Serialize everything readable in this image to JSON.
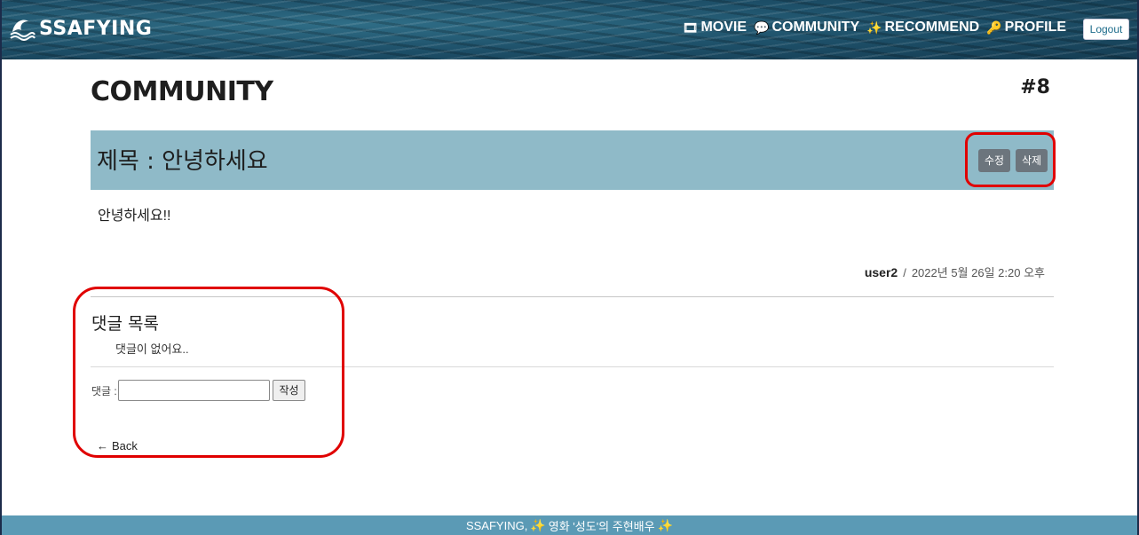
{
  "navbar": {
    "brand": "SSAFYING",
    "brand_icon": "wave-icon",
    "links": [
      {
        "label": "MOVIE",
        "icon": "film-icon",
        "glyph": "🎞"
      },
      {
        "label": "COMMUNITY",
        "icon": "chat-icon",
        "glyph": "💬"
      },
      {
        "label": "RECOMMEND",
        "icon": "sparkle-icon",
        "glyph": "✨"
      },
      {
        "label": "PROFILE",
        "icon": "key-icon",
        "glyph": "🔑"
      }
    ],
    "logout_label": "Logout"
  },
  "page": {
    "title": "COMMUNITY",
    "post_number": "#8"
  },
  "post": {
    "title": "제목 : 안녕하세요",
    "edit_label": "수정",
    "delete_label": "삭제",
    "content": "안녕하세요!!",
    "author": "user2",
    "separator": "/",
    "date": "2022년 5월 26일 2:20 오후"
  },
  "comments": {
    "heading": "댓글 목록",
    "empty_message": "댓글이 없어요..",
    "input_label": "댓글 :",
    "input_value": "",
    "submit_label": "작성"
  },
  "back": {
    "arrow": "←",
    "label": "Back"
  },
  "footer": {
    "text_before": "SSAFYING,",
    "text_middle": "영화 '성도'의 주현배우",
    "sparkle": "✨"
  },
  "colors": {
    "title_bar": "#8fbac8",
    "footer": "#5b9ab5",
    "button_secondary": "#6c757d",
    "annotation": "#e00000"
  }
}
